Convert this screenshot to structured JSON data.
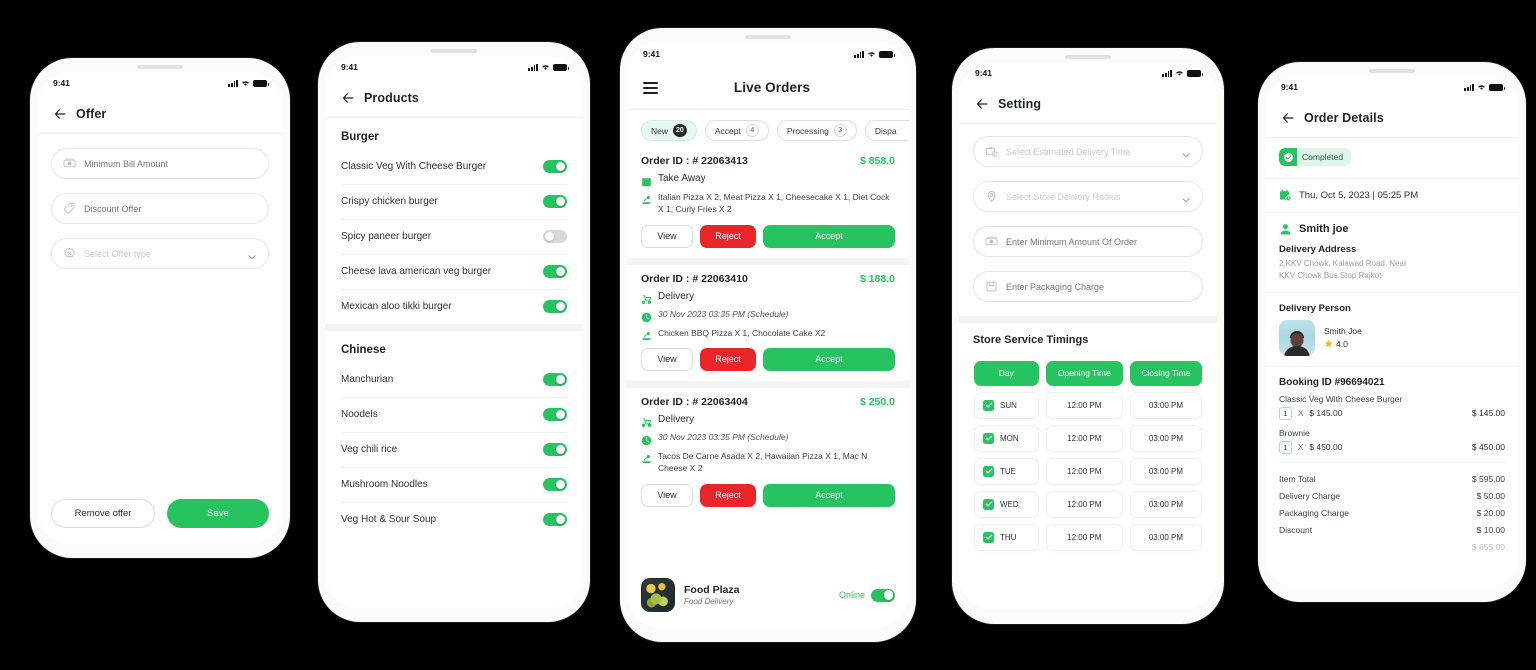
{
  "theme": {
    "accent_green": "#27c360",
    "reject_red": "#e8262a",
    "pill_active_bg": "#e6f8ee",
    "phone_body": "#fbfbf9"
  },
  "status_bar": {
    "time": "9:41"
  },
  "phone1": {
    "title": "Offer",
    "fields": [
      {
        "icon": "cash-icon",
        "placeholder": "Minimum Bill Amount",
        "value": "",
        "type": "text"
      },
      {
        "icon": "tag-icon",
        "placeholder": "Discount Offer",
        "value": "",
        "type": "text"
      },
      {
        "icon": "discount-badge-icon",
        "placeholder": "Select Offer type",
        "value": "",
        "type": "select"
      }
    ],
    "footer": {
      "remove_label": "Remove offer",
      "save_label": "Save"
    }
  },
  "phone2": {
    "title": "Products",
    "sections": [
      {
        "heading": "Burger",
        "items": [
          {
            "name": "Classic Veg With Cheese Burger",
            "enabled": true
          },
          {
            "name": "Crispy chicken burger",
            "enabled": true
          },
          {
            "name": "Spicy paneer burger",
            "enabled": false
          },
          {
            "name": "Cheese lava american veg burger",
            "enabled": true
          },
          {
            "name": "Mexican aloo tikki burger",
            "enabled": true
          }
        ]
      },
      {
        "heading": "Chinese",
        "items": [
          {
            "name": "Manchurian",
            "enabled": true
          },
          {
            "name": "Noodels",
            "enabled": true
          },
          {
            "name": "Veg chili rice",
            "enabled": true
          },
          {
            "name": "Mushroom Noodles",
            "enabled": true
          },
          {
            "name": "Veg Hot & Sour Soup",
            "enabled": true
          }
        ]
      }
    ]
  },
  "phone3": {
    "title": "Live Orders",
    "menu_icon": "hamburger-icon",
    "tabs": [
      {
        "label": "New",
        "count": "20",
        "active": true
      },
      {
        "label": "Accept",
        "count": "4",
        "active": false
      },
      {
        "label": "Processing",
        "count": "3",
        "active": false
      },
      {
        "label": "Dispa",
        "count": "",
        "active": false
      }
    ],
    "orders": [
      {
        "id_label": "Order ID : # 22063413",
        "amount": "$ 858.0",
        "type": "Take Away",
        "type_icon": "takeaway-bag-icon",
        "schedule": "",
        "items": "Italian Pizza X 2, Meat Pizza X 1, Cheesecake X 1, Diet Cock X 1, Curly Fries X 2",
        "buttons": {
          "view": "View",
          "reject": "Reject",
          "accept": "Accept"
        }
      },
      {
        "id_label": "Order ID : # 22063410",
        "amount": "$ 188.0",
        "type": "Delivery",
        "type_icon": "delivery-scooter-icon",
        "schedule": "30 Nov 2023 03:35 PM (Schedule)",
        "items": "Chicken BBQ Pizza X 1, Chocolate Cake X2",
        "buttons": {
          "view": "View",
          "reject": "Reject",
          "accept": "Accept"
        }
      },
      {
        "id_label": "Order ID : # 22063404",
        "amount": "$ 250.0",
        "type": "Delivery",
        "type_icon": "delivery-scooter-icon",
        "schedule": "30 Nov 2023 03:35 PM (Schedule)",
        "items": "Tacos De Carne Asada X 2, Hawaiian Pizza X 1, Mac N Cheese X 2",
        "buttons": {
          "view": "View",
          "reject": "Reject",
          "accept": "Accept"
        }
      }
    ],
    "store_bar": {
      "logo": "food-bowl-photo",
      "name": "Food Plaza",
      "subtitle": "Food Delivery",
      "status_label": "Online",
      "online": true
    }
  },
  "phone4": {
    "title": "Setting",
    "fields": [
      {
        "icon": "delivery-time-icon",
        "placeholder": "Select Estimated Delivery Time",
        "value": "",
        "type": "select"
      },
      {
        "icon": "location-pin-icon",
        "placeholder": "Select Store Delivery Radius",
        "value": "",
        "type": "select"
      },
      {
        "icon": "cash-icon",
        "placeholder": "Enter Minimum Amount Of Order",
        "value": "",
        "type": "text"
      },
      {
        "icon": "package-icon",
        "placeholder": "Enter Packaging Charge",
        "value": "",
        "type": "text"
      }
    ],
    "timings": {
      "section_title": "Store Service Timings",
      "headers": [
        "Day",
        "Opening Time",
        "Closing Time"
      ],
      "rows": [
        {
          "day": "SUN",
          "checked": true,
          "open": "12:00 PM",
          "close": "03:00 PM"
        },
        {
          "day": "MON",
          "checked": true,
          "open": "12:00 PM",
          "close": "03:00 PM"
        },
        {
          "day": "TUE",
          "checked": true,
          "open": "12:00 PM",
          "close": "03:00 PM"
        },
        {
          "day": "WED",
          "checked": true,
          "open": "12:00 PM",
          "close": "03:00 PM"
        },
        {
          "day": "THU",
          "checked": true,
          "open": "12:00 PM",
          "close": "03:00 PM"
        }
      ]
    }
  },
  "phone5": {
    "title": "Order Details",
    "status_badge": {
      "label": "Completed",
      "icon": "check-circle-icon"
    },
    "datetime": "Thu, Oct 5, 2023 | 05:25 PM",
    "datetime_icon": "calendar-clock-icon",
    "customer": {
      "name": "Smith joe",
      "icon": "person-icon"
    },
    "delivery_address": {
      "heading": "Delivery Address",
      "lines": [
        "2,KKV Chowk, Kalawad Road, Near",
        "KKV Chowk Bus Stop Rajkot"
      ]
    },
    "delivery_person": {
      "heading": "Delivery Person",
      "name": "Smith Joe",
      "rating": "4.0",
      "rating_icon": "star-icon",
      "avatar": "delivery-person-photo"
    },
    "booking": {
      "id_label": "Booking ID #96694021",
      "items": [
        {
          "name": "Classic Veg With Cheese Burger",
          "qty": "1",
          "x": "X",
          "unit_price": "$ 145.00",
          "line_total": "$ 145.00"
        },
        {
          "name": "Brownie",
          "qty": "1",
          "x": "X",
          "unit_price": "$ 450.00",
          "line_total": "$ 450.00"
        }
      ],
      "totals": [
        {
          "label": "Item Total",
          "value": "$ 595.00"
        },
        {
          "label": "Delivery Charge",
          "value": "$ 50.00"
        },
        {
          "label": "Packaging Charge",
          "value": "$ 20.00"
        },
        {
          "label": "Discount",
          "value": "$ 10.00"
        }
      ],
      "clipped_total": "$ 655.00"
    }
  }
}
